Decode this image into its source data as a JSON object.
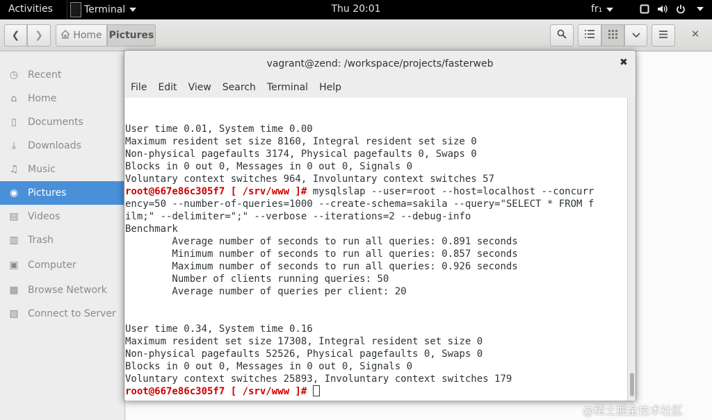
{
  "topbar": {
    "activities": "Activities",
    "app_name": "Terminal",
    "clock": "Thu 20:01",
    "locale": "fr₁"
  },
  "files": {
    "breadcrumb_home": "Home",
    "breadcrumb_current": "Pictures",
    "sidebar": [
      {
        "label": "Recent",
        "icon": "clock-icon"
      },
      {
        "label": "Home",
        "icon": "home-icon"
      },
      {
        "label": "Documents",
        "icon": "document-icon"
      },
      {
        "label": "Downloads",
        "icon": "download-icon"
      },
      {
        "label": "Music",
        "icon": "music-icon"
      },
      {
        "label": "Pictures",
        "icon": "camera-icon",
        "active": true
      },
      {
        "label": "Videos",
        "icon": "film-icon"
      },
      {
        "label": "Trash",
        "icon": "trash-icon"
      },
      {
        "label": "Computer",
        "icon": "drive-icon"
      },
      {
        "label": "Browse Network",
        "icon": "network-icon"
      },
      {
        "label": "Connect to Server",
        "icon": "server-icon"
      }
    ]
  },
  "terminal": {
    "title": "vagrant@zend: /workspace/projects/fasterweb",
    "menu": [
      "File",
      "Edit",
      "View",
      "Search",
      "Terminal",
      "Help"
    ],
    "prompt": "root@667e86c305f7 [ /srv/www ]#",
    "lines": [
      {
        "text": "User time 0.01, System time 0.00"
      },
      {
        "text": "Maximum resident set size 8160, Integral resident set size 0"
      },
      {
        "text": "Non-physical pagefaults 3174, Physical pagefaults 0, Swaps 0"
      },
      {
        "text": "Blocks in 0 out 0, Messages in 0 out 0, Signals 0"
      },
      {
        "text": "Voluntary context switches 964, Involuntary context switches 57"
      },
      {
        "prompt": true,
        "text": " mysqlslap --user=root --host=localhost --concurr"
      },
      {
        "text": "ency=50 --number-of-queries=1000 --create-schema=sakila --query=\"SELECT * FROM f"
      },
      {
        "text": "ilm;\" --delimiter=\";\" --verbose --iterations=2 --debug-info"
      },
      {
        "text": "Benchmark"
      },
      {
        "text": "        Average number of seconds to run all queries: 0.891 seconds"
      },
      {
        "text": "        Minimum number of seconds to run all queries: 0.857 seconds"
      },
      {
        "text": "        Maximum number of seconds to run all queries: 0.926 seconds"
      },
      {
        "text": "        Number of clients running queries: 50"
      },
      {
        "text": "        Average number of queries per client: 20"
      },
      {
        "text": ""
      },
      {
        "text": ""
      },
      {
        "text": "User time 0.34, System time 0.16"
      },
      {
        "text": "Maximum resident set size 17308, Integral resident set size 0"
      },
      {
        "text": "Non-physical pagefaults 52526, Physical pagefaults 0, Swaps 0"
      },
      {
        "text": "Blocks in 0 out 0, Messages in 0 out 0, Signals 0"
      },
      {
        "text": "Voluntary context switches 25893, Involuntary context switches 179"
      },
      {
        "prompt": true,
        "text": " ",
        "cursor": true
      }
    ]
  },
  "watermark": "@稀土掘金技术社区"
}
